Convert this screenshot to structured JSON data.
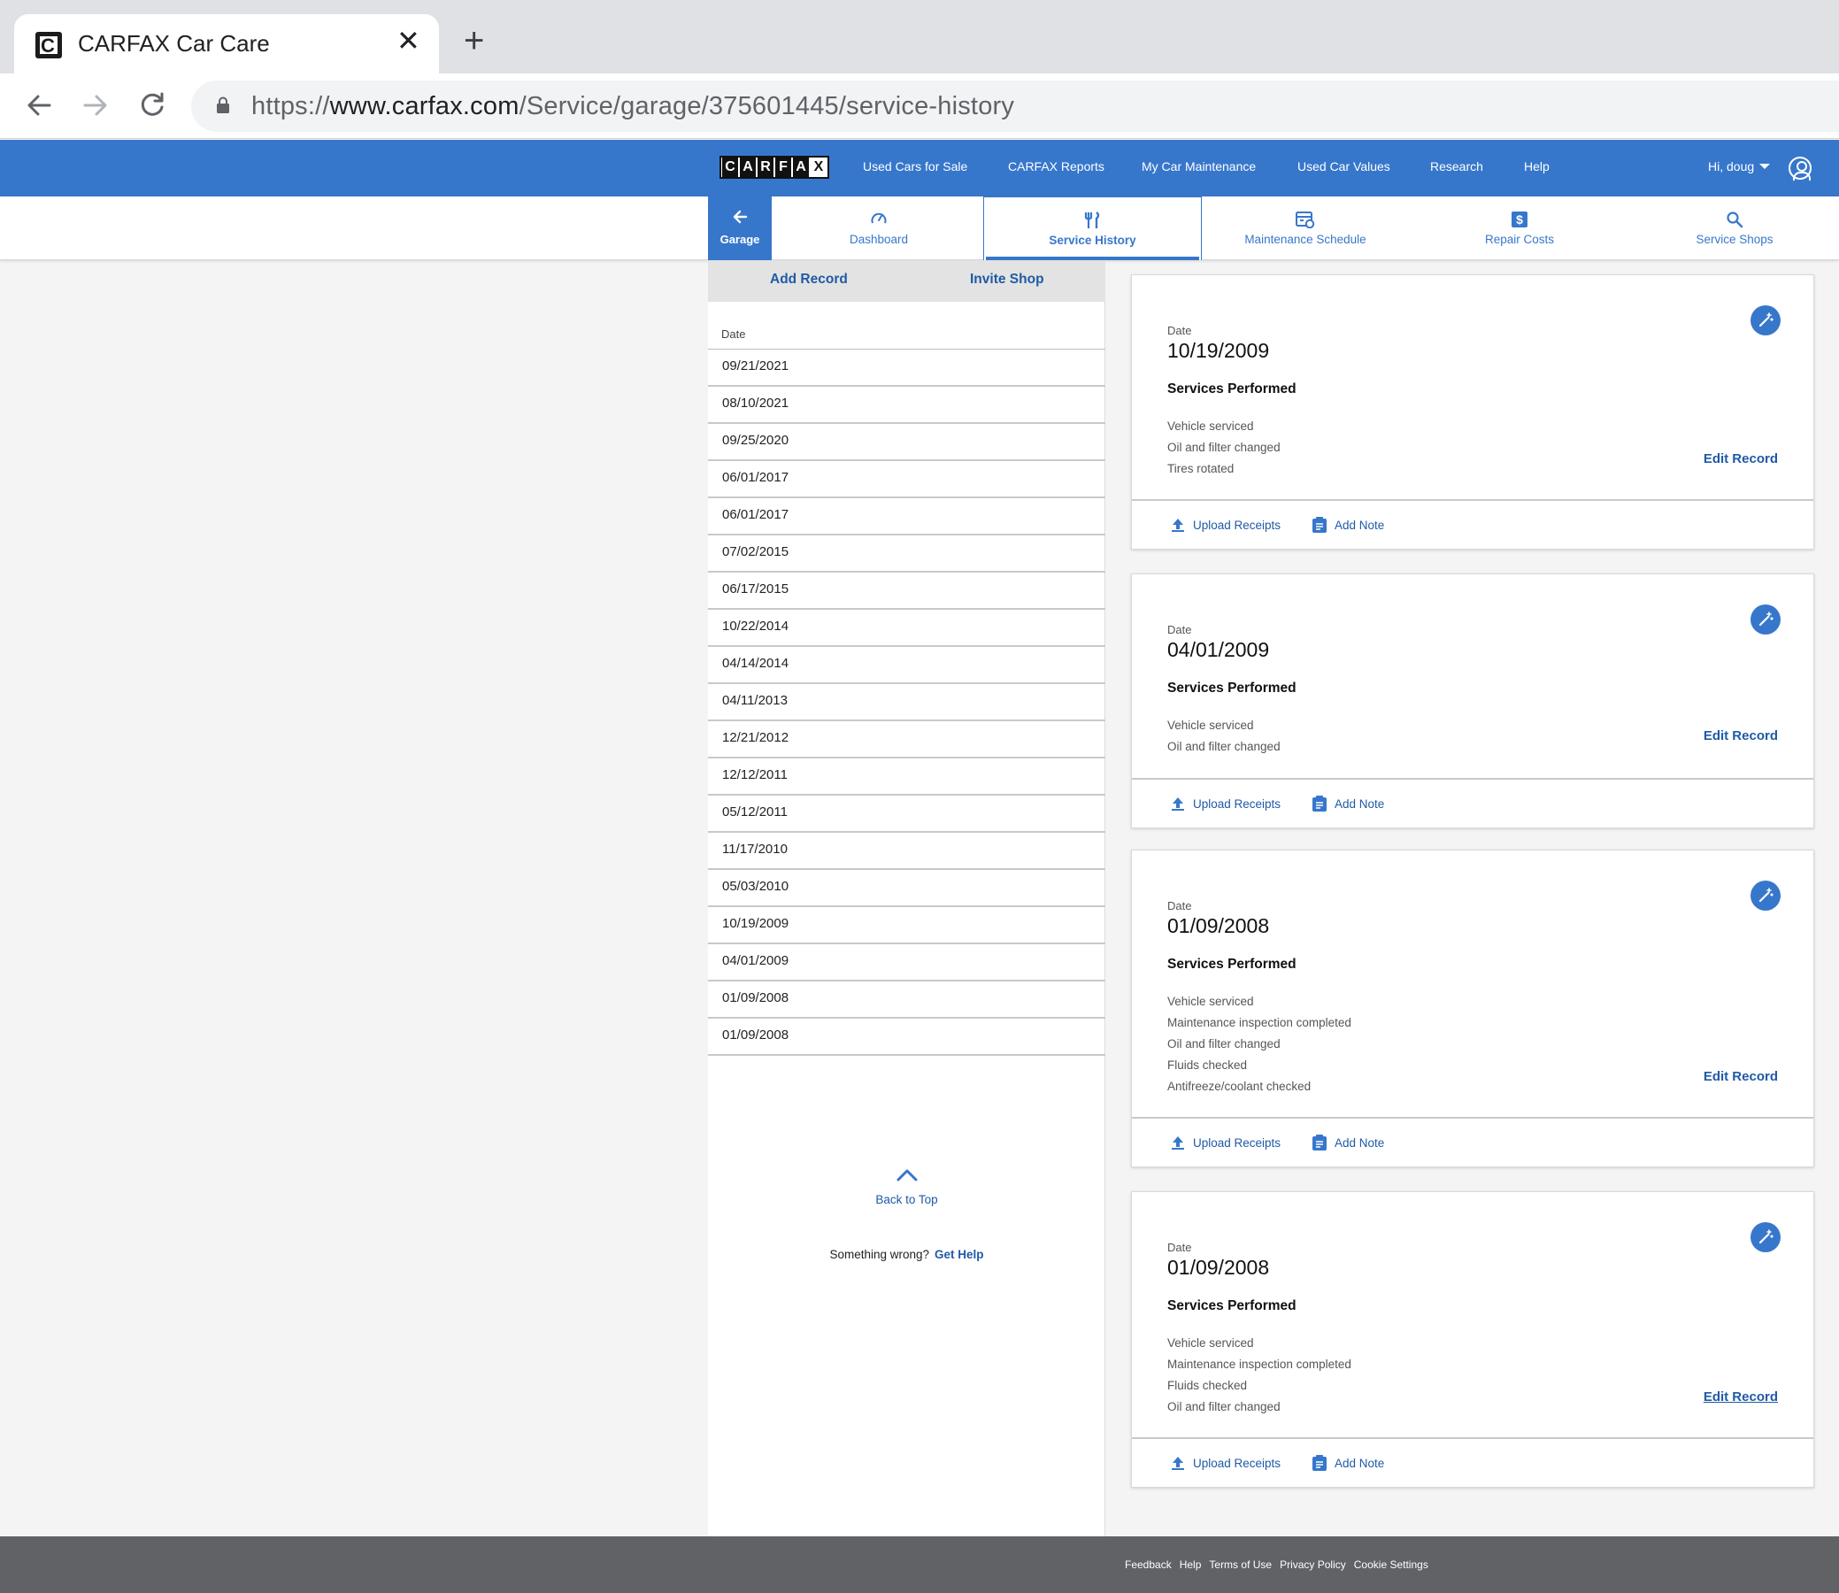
{
  "browser": {
    "tab_title": "CARFAX Car Care",
    "url_scheme": "https://",
    "url_host": "www.carfax.com",
    "url_path": "/Service/garage/375601445/service-history"
  },
  "topnav": {
    "logo_letters": [
      "C",
      "A",
      "R",
      "F",
      "A",
      "X"
    ],
    "links": [
      "Used Cars for Sale",
      "CARFAX Reports",
      "My Car Maintenance",
      "Used Car Values",
      "Research",
      "Help"
    ],
    "user_greeting": "Hi, doug",
    "brand_color": "#3777cb"
  },
  "subnav": {
    "garage_label": "Garage",
    "tabs": [
      {
        "label": "Dashboard",
        "icon": "speedometer-icon"
      },
      {
        "label": "Service History",
        "icon": "wrench-tools-icon",
        "active": true
      },
      {
        "label": "Maintenance Schedule",
        "icon": "calendar-gear-icon"
      },
      {
        "label": "Repair Costs",
        "icon": "dollar-icon"
      },
      {
        "label": "Service Shops",
        "icon": "search-icon"
      }
    ]
  },
  "sidebar": {
    "add_record": "Add Record",
    "invite_shop": "Invite Shop",
    "date_header": "Date",
    "dates": [
      "09/21/2021",
      "08/10/2021",
      "09/25/2020",
      "06/01/2017",
      "06/01/2017",
      "07/02/2015",
      "06/17/2015",
      "10/22/2014",
      "04/14/2014",
      "04/11/2013",
      "12/21/2012",
      "12/12/2011",
      "05/12/2011",
      "11/17/2010",
      "05/03/2010",
      "10/19/2009",
      "04/01/2009",
      "01/09/2008",
      "01/09/2008"
    ],
    "back_to_top": "Back to Top",
    "something_wrong": "Something wrong?",
    "get_help": "Get Help"
  },
  "records": [
    {
      "date_label": "Date",
      "date": "10/19/2009",
      "services_title": "Services Performed",
      "services": [
        "Vehicle serviced",
        "Oil and filter changed",
        "Tires rotated"
      ],
      "edit": "Edit Record",
      "upload": "Upload Receipts",
      "note": "Add Note"
    },
    {
      "date_label": "Date",
      "date": "04/01/2009",
      "services_title": "Services Performed",
      "services": [
        "Vehicle serviced",
        "Oil and filter changed"
      ],
      "edit": "Edit Record",
      "upload": "Upload Receipts",
      "note": "Add Note"
    },
    {
      "date_label": "Date",
      "date": "01/09/2008",
      "services_title": "Services Performed",
      "services": [
        "Vehicle serviced",
        "Maintenance inspection completed",
        "Oil and filter changed",
        "Fluids checked",
        "Antifreeze/coolant checked"
      ],
      "edit": "Edit Record",
      "upload": "Upload Receipts",
      "note": "Add Note"
    },
    {
      "date_label": "Date",
      "date": "01/09/2008",
      "services_title": "Services Performed",
      "services": [
        "Vehicle serviced",
        "Maintenance inspection completed",
        "Fluids checked",
        "Oil and filter changed"
      ],
      "edit": "Edit Record",
      "upload": "Upload Receipts",
      "note": "Add Note"
    }
  ],
  "footer": {
    "links": [
      "Feedback",
      "Help",
      "Terms of Use",
      "Privacy Policy",
      "Cookie Settings"
    ]
  }
}
